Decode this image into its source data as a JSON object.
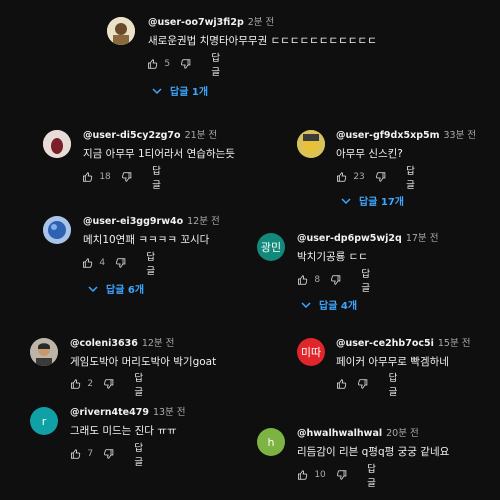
{
  "reply_label": "답글",
  "comments": [
    {
      "author": "@user-oo7wj3fi2p",
      "time": "2분 전",
      "text": "새로운권법 치명타아무무권 ㄷㄷㄷㄷㄷㄷㄷㄷㄷㄷㄷ",
      "likes": "5",
      "replies_label": "답글 1개",
      "avatar_color": "#e9e2c8"
    },
    {
      "author": "@user-di5cy2zg7o",
      "time": "21분 전",
      "text": "지금 아무무 1티어라서 연습하는듯",
      "likes": "18",
      "replies_label": "",
      "avatar_color": "#e5d6d2"
    },
    {
      "author": "@user-gf9dx5xp5m",
      "time": "33분 전",
      "text": "아무무 신스킨?",
      "likes": "23",
      "replies_label": "답글 17개",
      "avatar_color": "#c9b24a"
    },
    {
      "author": "@user-ei3gg9rw4o",
      "time": "12분 전",
      "text": "메치10연패 ㅋㅋㅋㅋ 꼬시다",
      "likes": "4",
      "replies_label": "답글 6개",
      "avatar_color": "#3b6fb5"
    },
    {
      "author": "@user-dp6pw5wj2q",
      "time": "17분 전",
      "text": "박치기공룡 ㄷㄷ",
      "likes": "8",
      "replies_label": "답글 4개",
      "avatar_text": "광민",
      "avatar_color": "#12897a"
    },
    {
      "author": "@coleni3636",
      "time": "12분 전",
      "text": "게임도박아 머리도박아 박기goat",
      "likes": "2",
      "replies_label": "",
      "avatar_color": "#6b6b6b"
    },
    {
      "author": "@user-ce2hb7oc5i",
      "time": "15분 전",
      "text": "페이커 아무무로 빡겜하네",
      "likes": "",
      "replies_label": "",
      "avatar_text": "미따",
      "avatar_color": "#e0262a"
    },
    {
      "author": "@rivern4te479",
      "time": "13분 전",
      "text": "그래도 미드는 진다 ㅠㅠ",
      "likes": "7",
      "replies_label": "",
      "avatar_text": "r",
      "avatar_color": "#10a1a6"
    },
    {
      "author": "@hwalhwalhwal",
      "time": "20분 전",
      "text": "리듬감이 리븐 q평q평 궁궁 같네요",
      "likes": "10",
      "replies_label": "",
      "avatar_text": "h",
      "avatar_color": "#7cb342"
    }
  ]
}
